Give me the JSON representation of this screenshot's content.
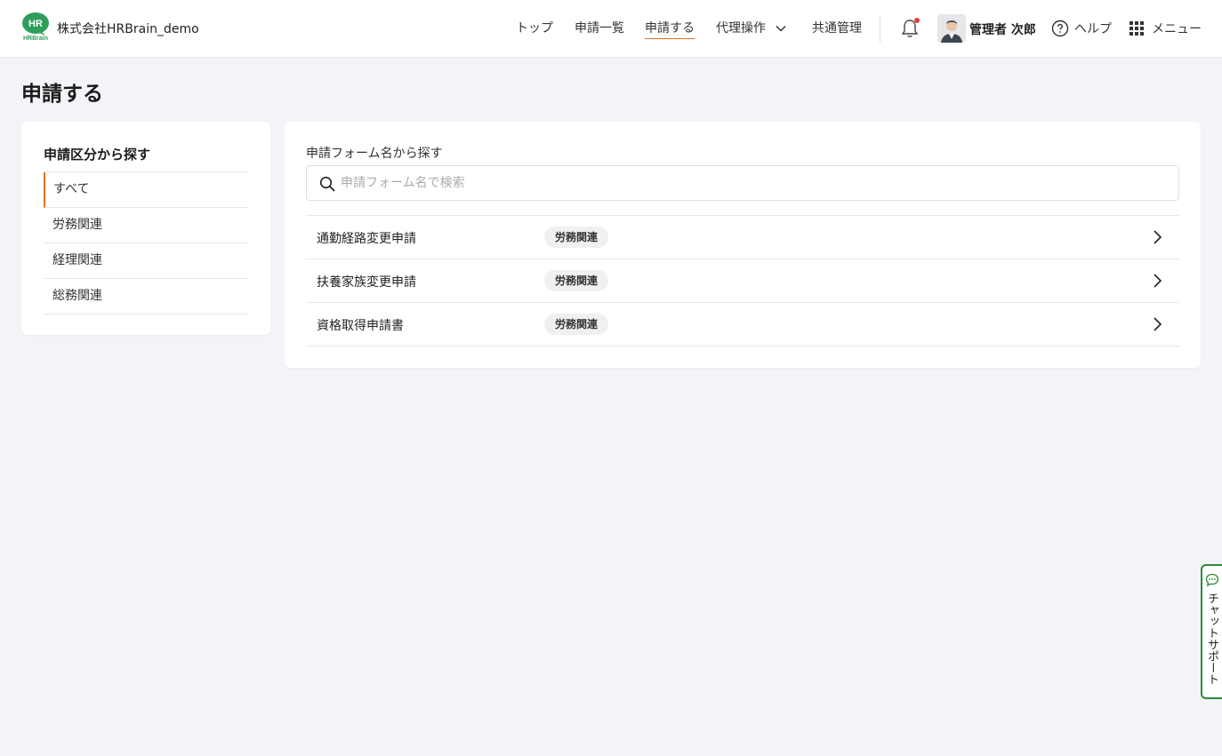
{
  "header": {
    "logo_text_top": "HR",
    "logo_text_bottom": "HRBrain",
    "company_name": "株式会社HRBrain_demo",
    "nav": [
      {
        "label": "トップ"
      },
      {
        "label": "申請一覧"
      },
      {
        "label": "申請する"
      },
      {
        "label": "代理操作"
      },
      {
        "label": "共通管理"
      }
    ],
    "user_name": "管理者 次郎",
    "help_label": "ヘルプ",
    "menu_label": "メニュー"
  },
  "page": {
    "title": "申請する"
  },
  "categories": {
    "title": "申請区分から探す",
    "items": [
      {
        "label": "すべて"
      },
      {
        "label": "労務関連"
      },
      {
        "label": "経理関連"
      },
      {
        "label": "総務関連"
      }
    ]
  },
  "search": {
    "label": "申請フォーム名から探す",
    "placeholder": "申請フォーム名で検索",
    "value": ""
  },
  "forms": [
    {
      "name": "通勤経路変更申請",
      "category": "労務関連"
    },
    {
      "name": "扶養家族変更申請",
      "category": "労務関連"
    },
    {
      "name": "資格取得申請書",
      "category": "労務関連"
    }
  ],
  "chat": {
    "label": "チャットサポート"
  },
  "colors": {
    "accent": "#e9711c",
    "brand_green": "#2f8a3c",
    "notification_dot": "#e53935",
    "background": "#f3f4f8"
  },
  "icons": {
    "bell": "bell-icon",
    "help": "question-circle-icon",
    "menu": "grid-icon",
    "search": "search-icon",
    "chevron": "chevron-right-icon",
    "chat": "chat-bubble-icon"
  }
}
